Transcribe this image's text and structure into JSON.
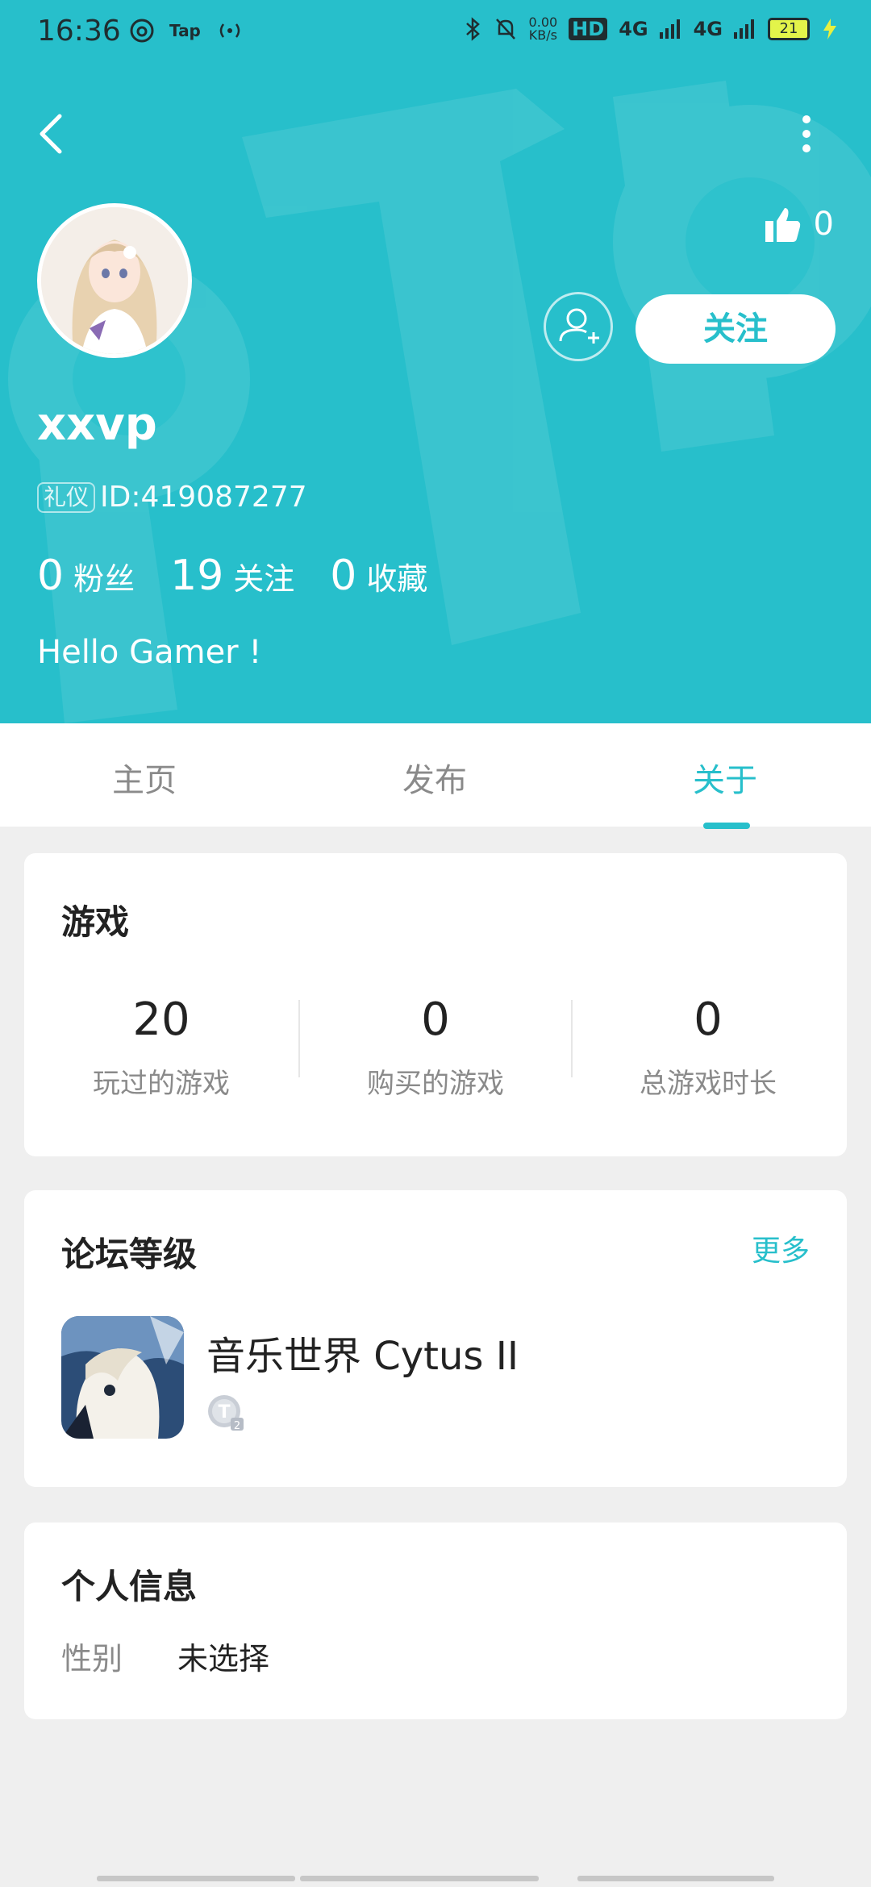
{
  "status_bar": {
    "time": "16:36",
    "left_icons": [
      "netease-music-icon",
      "taptap-icon",
      "hotspot-icon"
    ],
    "tap_text": "Tap",
    "speed_value": "0.00",
    "speed_unit": "KB/s",
    "hd_label": "HD",
    "network_1": "4G",
    "network_2": "4G",
    "battery": "21"
  },
  "header": {
    "background_color": "#27bfcb",
    "likes_count": "0",
    "follow_label": "关注",
    "username": "xxvp",
    "badge_label": "礼仪",
    "user_id": "ID:419087277",
    "stats": [
      {
        "num": "0",
        "label": "粉丝"
      },
      {
        "num": "19",
        "label": "关注"
      },
      {
        "num": "0",
        "label": "收藏"
      }
    ],
    "bio": "Hello Gamer !"
  },
  "tabs": [
    {
      "label": "主页",
      "active": false
    },
    {
      "label": "发布",
      "active": false
    },
    {
      "label": "关于",
      "active": true
    }
  ],
  "games_card": {
    "title": "游戏",
    "stats": [
      {
        "num": "20",
        "label": "玩过的游戏"
      },
      {
        "num": "0",
        "label": "购买的游戏"
      },
      {
        "num": "0",
        "label": "总游戏时长"
      }
    ]
  },
  "forum_card": {
    "title": "论坛等级",
    "more_label": "更多",
    "game_name": "音乐世界 Cytus II",
    "level_badge": "T2"
  },
  "info_card": {
    "title": "个人信息",
    "gender_label": "性别",
    "gender_value": "未选择"
  }
}
